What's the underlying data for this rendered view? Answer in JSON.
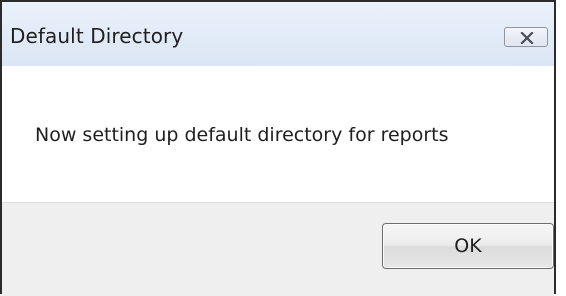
{
  "window": {
    "title": "Default Directory",
    "close_icon": "close-icon"
  },
  "dialog": {
    "message": "Now setting up default directory for reports",
    "ok_label": "OK"
  }
}
